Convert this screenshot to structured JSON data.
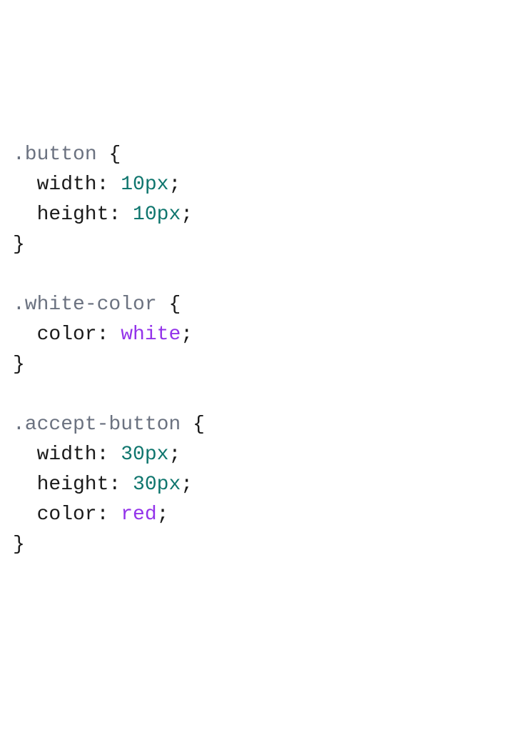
{
  "rules": [
    {
      "selector": ".button",
      "declarations": [
        {
          "property": "width",
          "value": "10",
          "unit": "px",
          "valueType": "number"
        },
        {
          "property": "height",
          "value": "10",
          "unit": "px",
          "valueType": "number"
        }
      ]
    },
    {
      "selector": ".white-color",
      "declarations": [
        {
          "property": "color",
          "value": "white",
          "unit": "",
          "valueType": "keyword"
        }
      ]
    },
    {
      "selector": ".accept-button",
      "declarations": [
        {
          "property": "width",
          "value": "30",
          "unit": "px",
          "valueType": "number"
        },
        {
          "property": "height",
          "value": "30",
          "unit": "px",
          "valueType": "number"
        },
        {
          "property": "color",
          "value": "red",
          "unit": "",
          "valueType": "keyword"
        }
      ]
    }
  ]
}
